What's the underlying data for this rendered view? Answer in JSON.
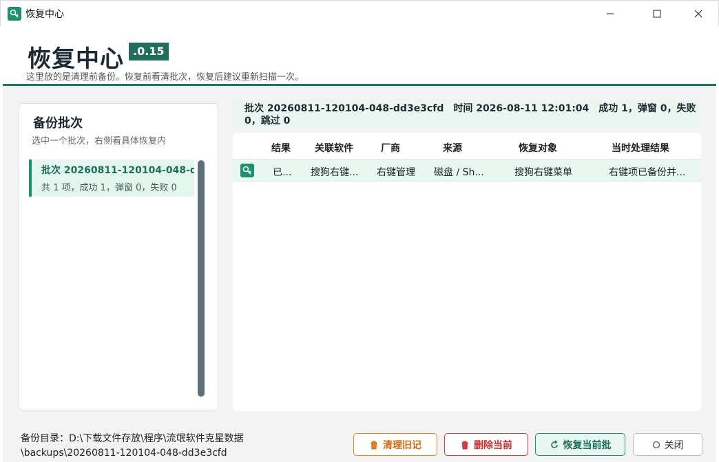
{
  "window": {
    "title": "恢复中心"
  },
  "header": {
    "title": "恢复中心",
    "version": ".0.15",
    "subtitle": "这里放的是清理前备份。恢复前看清批次，恢复后建议重新扫描一次。"
  },
  "sidebar": {
    "title": "备份批次",
    "hint": "选中一个批次，右侧看具体恢复内",
    "items": [
      {
        "title": "批次 20260811-120104-048-d...",
        "summary": "共 1 项，成功 1，弹窗 0，失败 0"
      }
    ]
  },
  "batch_summary": "批次 20260811-120104-048-dd3e3cfd　时间 2026-08-11 12:01:04　成功 1，弹窗 0，失败 0，跳过 0",
  "table": {
    "columns": [
      "结果",
      "关联软件",
      "厂商",
      "来源",
      "恢复对象",
      "当时处理结果"
    ],
    "rows": [
      {
        "result": "已...",
        "software": "搜狗右键...",
        "vendor": "右键管理",
        "source": "磁盘 / Sh...",
        "target": "搜狗右键菜单",
        "outcome": "右键项已备份并..."
      }
    ]
  },
  "footer": {
    "path_line1": "备份目录：D:\\下载文件存放\\程序\\流氓软件克星数据",
    "path_line2": "\\backups\\20260811-120104-048-dd3e3cfd",
    "buttons": {
      "clear": "清理旧记",
      "delete": "删除当前",
      "restore": "恢复当前批",
      "close": "关闭"
    }
  },
  "colors": {
    "accent": "#1e8f6f",
    "warning": "#e6832a",
    "danger": "#d93b3b"
  },
  "icons": [
    "app-icon",
    "minimize-icon",
    "maximize-icon",
    "close-icon",
    "trash-icon",
    "refresh-icon",
    "circle-icon"
  ]
}
